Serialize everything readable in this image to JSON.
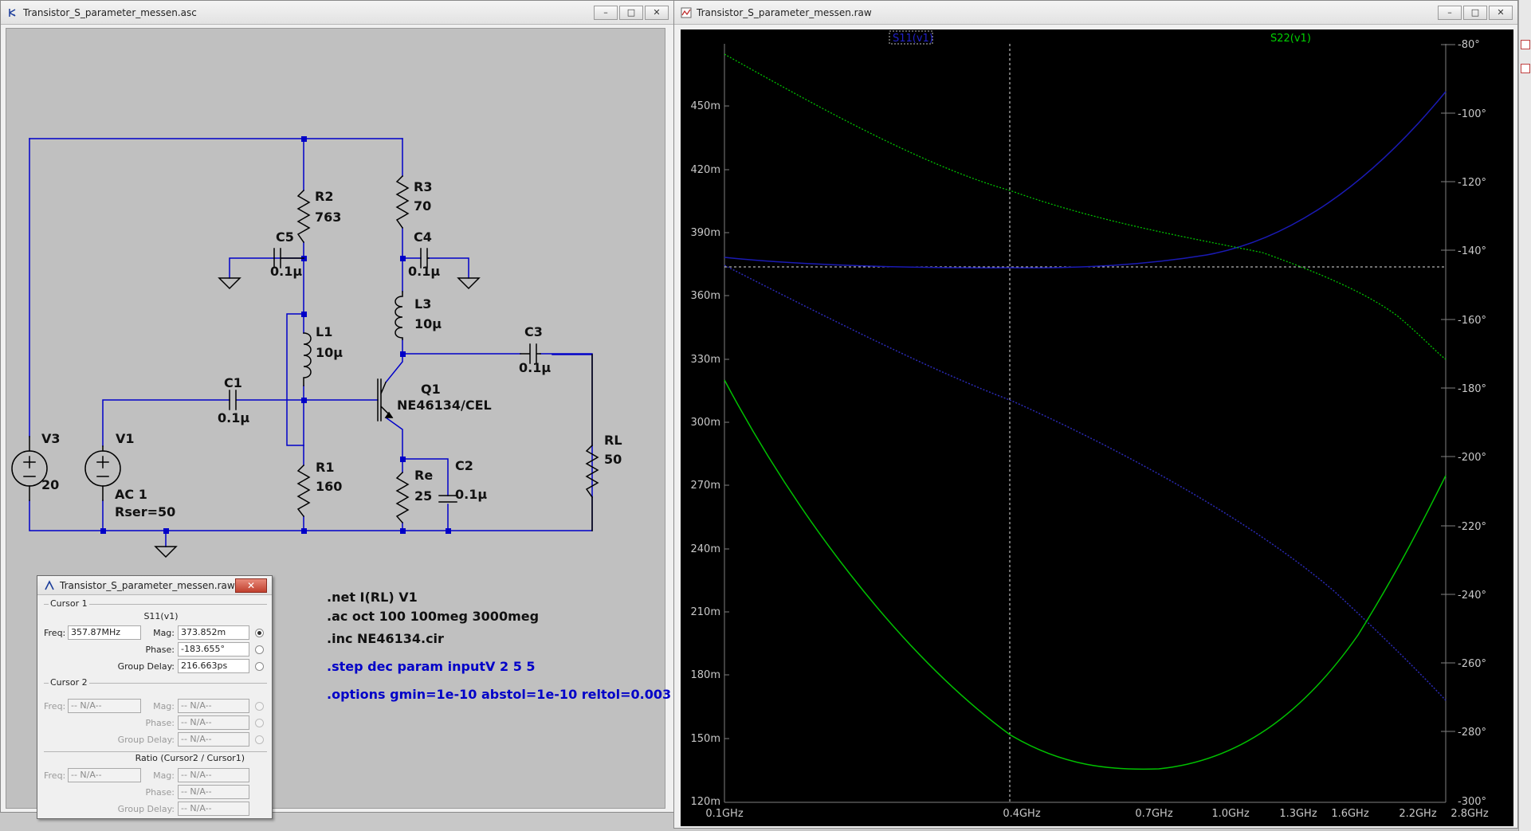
{
  "schematic_window": {
    "title": "Transistor_S_parameter_messen.asc",
    "buttons": [
      "–",
      "□",
      "✕"
    ]
  },
  "waveform_window": {
    "title": "Transistor_S_parameter_messen.raw",
    "buttons": [
      "–",
      "□",
      "✕"
    ],
    "trace_labels": [
      "S11(v1)",
      "S22(v1)"
    ],
    "left_ticks": [
      "450m",
      "420m",
      "390m",
      "360m",
      "330m",
      "300m",
      "270m",
      "240m",
      "210m",
      "180m",
      "150m",
      "120m"
    ],
    "right_ticks": [
      "-80°",
      "-100°",
      "-120°",
      "-140°",
      "-160°",
      "-180°",
      "-200°",
      "-220°",
      "-240°",
      "-260°",
      "-280°",
      "-300°"
    ],
    "x_ticks": [
      "0.1GHz",
      "0.4GHz",
      "0.7GHz",
      "1.0GHz",
      "1.3GHz",
      "1.6GHz",
      "2.2GHz",
      "2.8GHz"
    ]
  },
  "components": {
    "R2": {
      "name": "R2",
      "value": "763"
    },
    "R3": {
      "name": "R3",
      "value": "70"
    },
    "C5": {
      "name": "C5",
      "value": "0.1µ"
    },
    "C4": {
      "name": "C4",
      "value": "0.1µ"
    },
    "L1": {
      "name": "L1",
      "value": "10µ"
    },
    "L3": {
      "name": "L3",
      "value": "10µ"
    },
    "C3": {
      "name": "C3",
      "value": "0.1µ"
    },
    "C1": {
      "name": "C1",
      "value": "0.1µ"
    },
    "Q1": {
      "name": "Q1",
      "value": "NE46134/CEL"
    },
    "V3": {
      "name": "V3",
      "value": "20"
    },
    "V1": {
      "name": "V1",
      "value1": "AC 1",
      "value2": "Rser=50"
    },
    "RL": {
      "name": "RL",
      "value": "50"
    },
    "R1": {
      "name": "R1",
      "value": "160"
    },
    "Re": {
      "name": "Re",
      "value": "25"
    },
    "C2": {
      "name": "C2",
      "value": "0.1µ"
    }
  },
  "spice_directives": {
    "net": ".net I(RL) V1",
    "ac": ".ac oct 100 100meg 3000meg",
    "inc": ".inc NE46134.cir",
    "step": ".step dec param inputV 2 5 5",
    "options": ".options gmin=1e-10 abstol=1e-10 reltol=0.003"
  },
  "cursor_dialog": {
    "title": "Transistor_S_parameter_messen.raw",
    "close": "✕",
    "cursor1_label": "Cursor 1",
    "trace": "S11(v1)",
    "freq_label": "Freq:",
    "freq_value": "357.87MHz",
    "mag_label": "Mag:",
    "mag_value": "373.852m",
    "phase_label": "Phase:",
    "phase_value": "-183.655°",
    "gd_label": "Group Delay:",
    "gd_value": "216.663ps",
    "cursor2_label": "Cursor 2",
    "na": "-- N/A--",
    "ratio_label": "Ratio (Cursor2 / Cursor1)"
  },
  "colors": {
    "wire": "#0000c8",
    "component": "#000000",
    "s11": "#1a1ab4",
    "s22": "#00c000",
    "plot_bg": "#000000"
  }
}
